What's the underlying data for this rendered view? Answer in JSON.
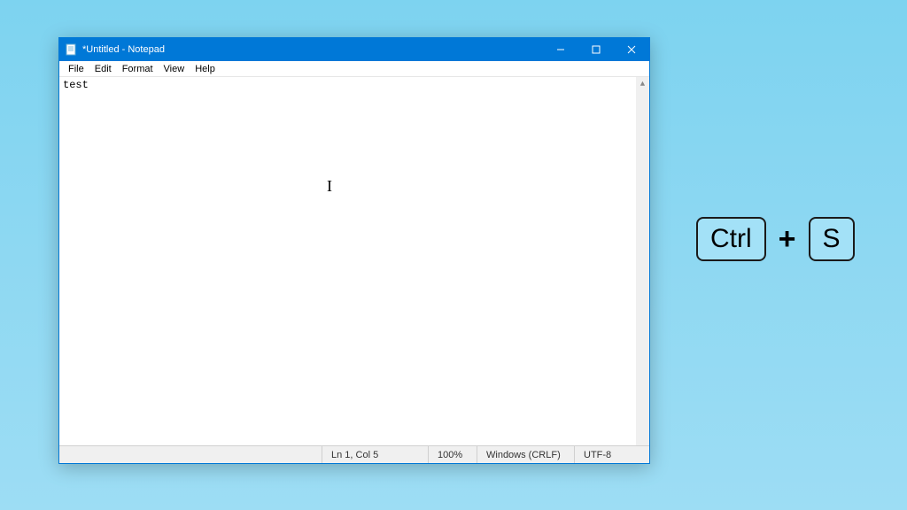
{
  "window": {
    "title": "*Untitled - Notepad"
  },
  "menu": {
    "file": "File",
    "edit": "Edit",
    "format": "Format",
    "view": "View",
    "help": "Help"
  },
  "editor": {
    "content": "test"
  },
  "status": {
    "position": "Ln 1, Col 5",
    "zoom": "100%",
    "line_ending": "Windows (CRLF)",
    "encoding": "UTF-8"
  },
  "shortcut": {
    "key1": "Ctrl",
    "plus": "+",
    "key2": "S"
  }
}
